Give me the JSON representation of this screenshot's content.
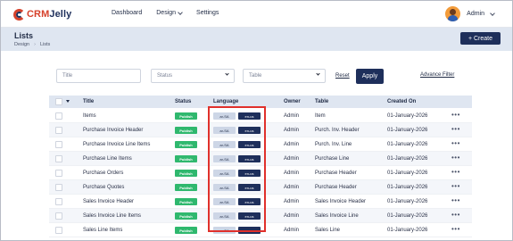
{
  "brand": {
    "name_part1": "CRM",
    "name_part2": "Jelly"
  },
  "nav": {
    "items": [
      {
        "label": "Dashboard"
      },
      {
        "label": "Design"
      },
      {
        "label": "Settings"
      }
    ]
  },
  "user": {
    "name": "Admin"
  },
  "page": {
    "title": "Lists",
    "breadcrumb": [
      "Design",
      "Lists"
    ],
    "create_label": "+ Create"
  },
  "filters": {
    "title_placeholder": "Title",
    "status_value": "Status",
    "table_value": "Table",
    "reset_label": "Reset",
    "apply_label": "Apply",
    "advance_label": "Advance Filter"
  },
  "table": {
    "columns": [
      "Title",
      "Status",
      "Language",
      "Owner",
      "Table",
      "Created On"
    ],
    "rows": [
      {
        "title": "Items",
        "status": "Publish",
        "lang1": "ar-SA",
        "lang2": "en-us",
        "owner": "Admin",
        "table": "Item",
        "created": "01-January-2026"
      },
      {
        "title": "Purchase Invoice Header",
        "status": "Publish",
        "lang1": "ar-SA",
        "lang2": "en-us",
        "owner": "Admin",
        "table": "Purch. Inv. Header",
        "created": "01-January-2026"
      },
      {
        "title": "Purchase Invoice Line Items",
        "status": "Publish",
        "lang1": "ar-SA",
        "lang2": "en-us",
        "owner": "Admin",
        "table": "Purch. Inv. Line",
        "created": "01-January-2026"
      },
      {
        "title": "Purchase Line Items",
        "status": "Publish",
        "lang1": "ar-SA",
        "lang2": "en-us",
        "owner": "Admin",
        "table": "Purchase Line",
        "created": "01-January-2026"
      },
      {
        "title": "Purchase Orders",
        "status": "Publish",
        "lang1": "ar-SA",
        "lang2": "en-us",
        "owner": "Admin",
        "table": "Purchase Header",
        "created": "01-January-2026"
      },
      {
        "title": "Purchase Quotes",
        "status": "Publish",
        "lang1": "ar-SA",
        "lang2": "en-us",
        "owner": "Admin",
        "table": "Purchase Header",
        "created": "01-January-2026"
      },
      {
        "title": "Sales Invoice Header",
        "status": "Publish",
        "lang1": "ar-SA",
        "lang2": "en-us",
        "owner": "Admin",
        "table": "Sales Invoice Header",
        "created": "01-January-2026"
      },
      {
        "title": "Sales Invoice Line Items",
        "status": "Publish",
        "lang1": "ar-SA",
        "lang2": "en-us",
        "owner": "Admin",
        "table": "Sales Invoice Line",
        "created": "01-January-2026"
      },
      {
        "title": "Sales Line Items",
        "status": "Publish",
        "lang1": "ar-SA",
        "lang2": "en-us",
        "owner": "Admin",
        "table": "Sales Line",
        "created": "01-January-2026"
      }
    ],
    "more_glyph": "•••"
  },
  "colors": {
    "primary": "#1e2f5b",
    "accent": "#d6412b",
    "publish": "#2fb86e",
    "highlight": "#e0302b",
    "header_band": "#dfe6f1"
  },
  "icons": [
    "crmjelly-logo-icon",
    "chevron-down-icon",
    "user-avatar-icon",
    "more-horizontal-icon",
    "checkbox-icon",
    "caret-down-icon"
  ]
}
